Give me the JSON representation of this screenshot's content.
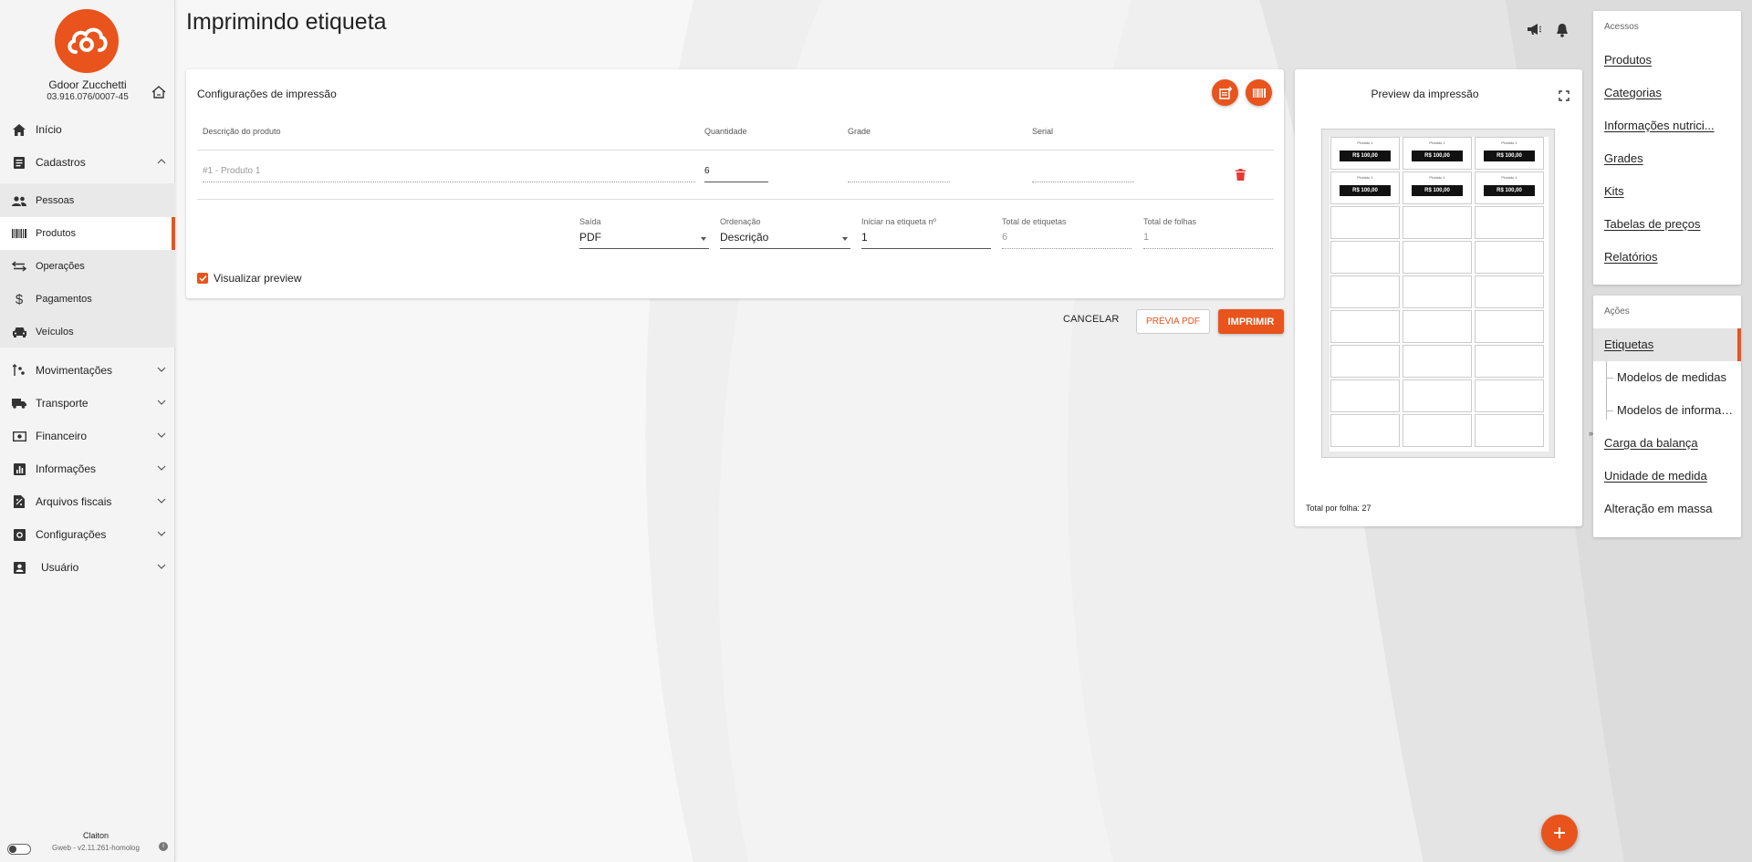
{
  "page": {
    "title": "Imprimindo etiqueta"
  },
  "colors": {
    "accent": "#e8541c",
    "sidebar_bg": "#f4f4f4"
  },
  "profile": {
    "name": "Gdoor Zucchetti",
    "document": "03.916.076/0007-45"
  },
  "sidebar": {
    "items": [
      {
        "label": "Início",
        "icon": "home-icon"
      },
      {
        "label": "Cadastros",
        "icon": "document-icon",
        "expanded": true
      },
      {
        "label": "Pessoas",
        "icon": "people-icon"
      },
      {
        "label": "Produtos",
        "icon": "barcode-icon",
        "active": true
      },
      {
        "label": "Operações",
        "icon": "swap-icon"
      },
      {
        "label": "Pagamentos",
        "icon": "dollar-icon"
      },
      {
        "label": "Veículos",
        "icon": "car-icon"
      },
      {
        "label": "Movimentações",
        "icon": "movements-icon"
      },
      {
        "label": "Transporte",
        "icon": "truck-icon"
      },
      {
        "label": "Financeiro",
        "icon": "cash-icon"
      },
      {
        "label": "Informações",
        "icon": "chart-icon"
      },
      {
        "label": "Arquivos fiscais",
        "icon": "file-fiscal-icon"
      },
      {
        "label": "Configurações",
        "icon": "settings-icon"
      },
      {
        "label": "Usuário",
        "icon": "user-icon"
      }
    ],
    "footer": {
      "user": "Claiton",
      "version": "Gweb - v2.11.261-homolog"
    }
  },
  "config": {
    "title": "Configurações de impressão",
    "columns": [
      "Descrição do produto",
      "Quantidade",
      "Grade",
      "Serial"
    ],
    "row": {
      "product": "#1 - Produto 1",
      "quantity": "6"
    },
    "fields": {
      "saida": {
        "label": "Saída",
        "value": "PDF"
      },
      "ordenacao": {
        "label": "Ordenação",
        "value": "Descrição"
      },
      "iniciar": {
        "label": "Iniciar na etiqueta nº",
        "value": "1"
      },
      "total_etiquetas": {
        "label": "Total de etiquetas",
        "value": "6"
      },
      "total_folhas": {
        "label": "Total de folhas",
        "value": "1"
      }
    },
    "preview_checkbox": {
      "label": "Visualizar preview",
      "checked": true
    }
  },
  "actions": {
    "cancel": "CANCELAR",
    "preview_pdf": "PRÉVIA PDF",
    "print": "IMPRIMIR"
  },
  "preview": {
    "title": "Preview da impressão",
    "label_product": "Produto 1",
    "label_price": "R$ 100,00",
    "printed_labels": 6,
    "labels_per_sheet": 27,
    "total_text": "Total por folha: 27"
  },
  "acessos": {
    "title": "Acessos",
    "links": [
      "Produtos",
      "Categorias",
      "Informações nutrici...",
      "Grades",
      "Kits",
      "Tabelas de preços",
      "Relatórios"
    ]
  },
  "acoes": {
    "title": "Ações",
    "links": [
      "Etiquetas",
      "Modelos de medidas",
      "Modelos de informaç...",
      "Carga da balança",
      "Unidade de medida",
      "Alteração em massa"
    ]
  }
}
